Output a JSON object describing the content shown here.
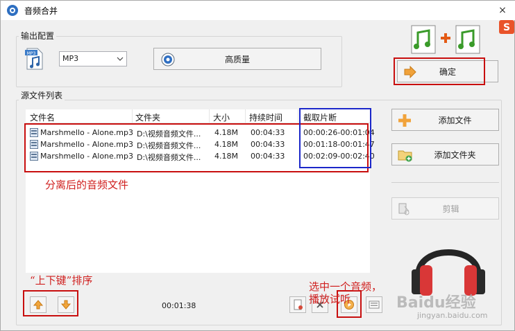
{
  "window": {
    "title": "音频合并",
    "close_glyph": "×"
  },
  "output_config": {
    "group_label": "输出配置",
    "format": {
      "value": "MP3"
    },
    "quality_button": "高质量",
    "format_icon_text": "MP3"
  },
  "confirm_button": "确定",
  "source_list": {
    "group_label": "源文件列表",
    "columns": [
      "文件名",
      "文件夹",
      "大小",
      "持续时间",
      "截取片断"
    ],
    "rows": [
      {
        "name": "Marshmello - Alone.mp3",
        "folder": "D:\\视频音频文件...",
        "size": "4.18M",
        "duration": "00:04:33",
        "clip": "00:00:26-00:01:04"
      },
      {
        "name": "Marshmello - Alone.mp3",
        "folder": "D:\\视频音频文件...",
        "size": "4.18M",
        "duration": "00:04:33",
        "clip": "00:01:18-00:01:47"
      },
      {
        "name": "Marshmello - Alone.mp3",
        "folder": "D:\\视频音频文件...",
        "size": "4.18M",
        "duration": "00:04:33",
        "clip": "00:02:09-00:02:40"
      }
    ],
    "total_time": "00:01:38"
  },
  "side_buttons": {
    "add_file": "添加文件",
    "add_folder": "添加文件夹",
    "cut": "剪辑"
  },
  "annotations": {
    "separated_files": "分离后的音频文件",
    "updown_sort": "“上下键”排序",
    "select_play": "选中一个音频，",
    "select_play_2": "播放试听"
  },
  "watermark": {
    "brand": "Baidu经验",
    "url": "jingyan.baidu.com"
  },
  "colors": {
    "annotation_red": "#c80e0e",
    "annotation_blue": "#1b27c9",
    "window_bg": "#f0f0f0"
  }
}
